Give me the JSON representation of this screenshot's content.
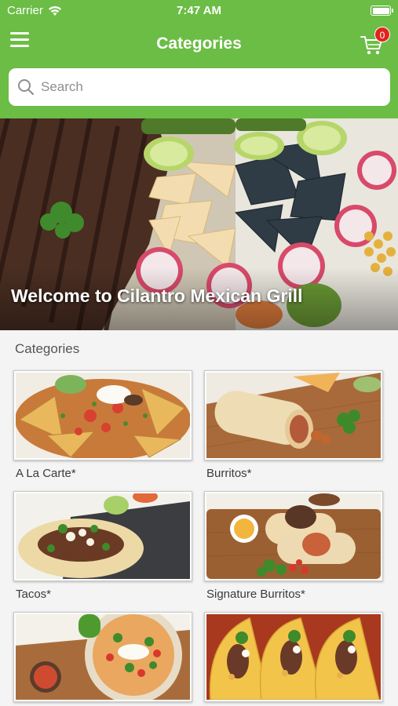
{
  "status_bar": {
    "carrier": "Carrier",
    "time": "7:47 AM"
  },
  "header": {
    "title": "Categories",
    "cart_count": "0"
  },
  "search": {
    "placeholder": "Search"
  },
  "hero": {
    "title": "Welcome to Cilantro Mexican Grill"
  },
  "section": {
    "title": "Categories"
  },
  "categories": [
    {
      "label": "A La Carte*",
      "image": "nachos-photo"
    },
    {
      "label": "Burritos*",
      "image": "burrito-photo"
    },
    {
      "label": "Tacos*",
      "image": "taco-photo"
    },
    {
      "label": "Signature Burritos*",
      "image": "signature-burrito-photo"
    },
    {
      "label": "",
      "image": "rice-bowl-photo"
    },
    {
      "label": "",
      "image": "hard-tacos-photo"
    }
  ],
  "colors": {
    "brand": "#6bbd45",
    "badge": "#e0241c"
  }
}
